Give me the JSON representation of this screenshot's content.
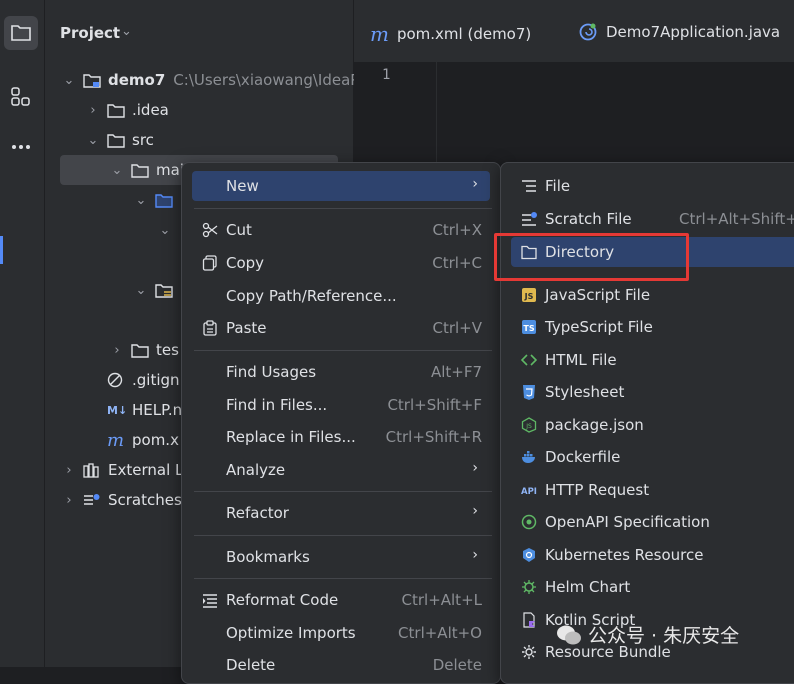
{
  "project_panel": {
    "title": "Project",
    "tree": [
      {
        "label": "demo7",
        "path": "C:\\Users\\xiaowang\\IdeaPr"
      },
      {
        "label": ".idea"
      },
      {
        "label": "src"
      },
      {
        "label": "mai"
      },
      {
        "label": "tes"
      },
      {
        "label": ".gitign"
      },
      {
        "label": "HELP.n"
      },
      {
        "label": "pom.x"
      },
      {
        "label": "External L"
      },
      {
        "label": "Scratches"
      }
    ]
  },
  "editor": {
    "tabs": [
      {
        "label": "pom.xml (demo7)"
      },
      {
        "label": "Demo7Application.java"
      }
    ],
    "line_numbers": [
      "1"
    ]
  },
  "context_menu": {
    "items": {
      "new": {
        "label": "New"
      },
      "cut": {
        "label": "Cut",
        "shortcut": "Ctrl+X"
      },
      "copy": {
        "label": "Copy",
        "shortcut": "Ctrl+C"
      },
      "copy_path": {
        "label": "Copy Path/Reference..."
      },
      "paste": {
        "label": "Paste",
        "shortcut": "Ctrl+V"
      },
      "find_usages": {
        "label": "Find Usages",
        "shortcut": "Alt+F7"
      },
      "find_in_files": {
        "label": "Find in Files...",
        "shortcut": "Ctrl+Shift+F"
      },
      "replace_in_files": {
        "label": "Replace in Files...",
        "shortcut": "Ctrl+Shift+R"
      },
      "analyze": {
        "label": "Analyze"
      },
      "refactor": {
        "label": "Refactor"
      },
      "bookmarks": {
        "label": "Bookmarks"
      },
      "reformat_code": {
        "label": "Reformat Code",
        "shortcut": "Ctrl+Alt+L"
      },
      "optimize_imports": {
        "label": "Optimize Imports",
        "shortcut": "Ctrl+Alt+O"
      },
      "delete": {
        "label": "Delete",
        "shortcut": "Delete"
      }
    }
  },
  "new_submenu": {
    "items": [
      {
        "label": "File",
        "icon": "file-lines-icon"
      },
      {
        "label": "Scratch File",
        "shortcut": "Ctrl+Alt+Shift+I",
        "icon": "scratch-file-icon"
      },
      {
        "label": "Directory",
        "icon": "folder-icon"
      },
      {
        "label": "JavaScript File",
        "icon": "js-icon"
      },
      {
        "label": "TypeScript File",
        "icon": "ts-icon"
      },
      {
        "label": "HTML File",
        "icon": "html-icon"
      },
      {
        "label": "Stylesheet",
        "icon": "css-icon"
      },
      {
        "label": "package.json",
        "icon": "nodejs-icon"
      },
      {
        "label": "Dockerfile",
        "icon": "docker-icon"
      },
      {
        "label": "HTTP Request",
        "icon": "api-icon"
      },
      {
        "label": "OpenAPI Specification",
        "icon": "openapi-icon"
      },
      {
        "label": "Kubernetes Resource",
        "icon": "kubernetes-icon"
      },
      {
        "label": "Helm Chart",
        "icon": "helm-icon"
      },
      {
        "label": "Kotlin Script",
        "icon": "kotlin-icon"
      },
      {
        "label": "Resource Bundle",
        "icon": "gear-icon"
      }
    ],
    "highlight_color": "#e53935"
  },
  "watermark": {
    "text": "公众号 · 朱厌安全"
  },
  "colors": {
    "selection": "#2e436e",
    "folder": "#548af7",
    "accent": "#548af7"
  }
}
